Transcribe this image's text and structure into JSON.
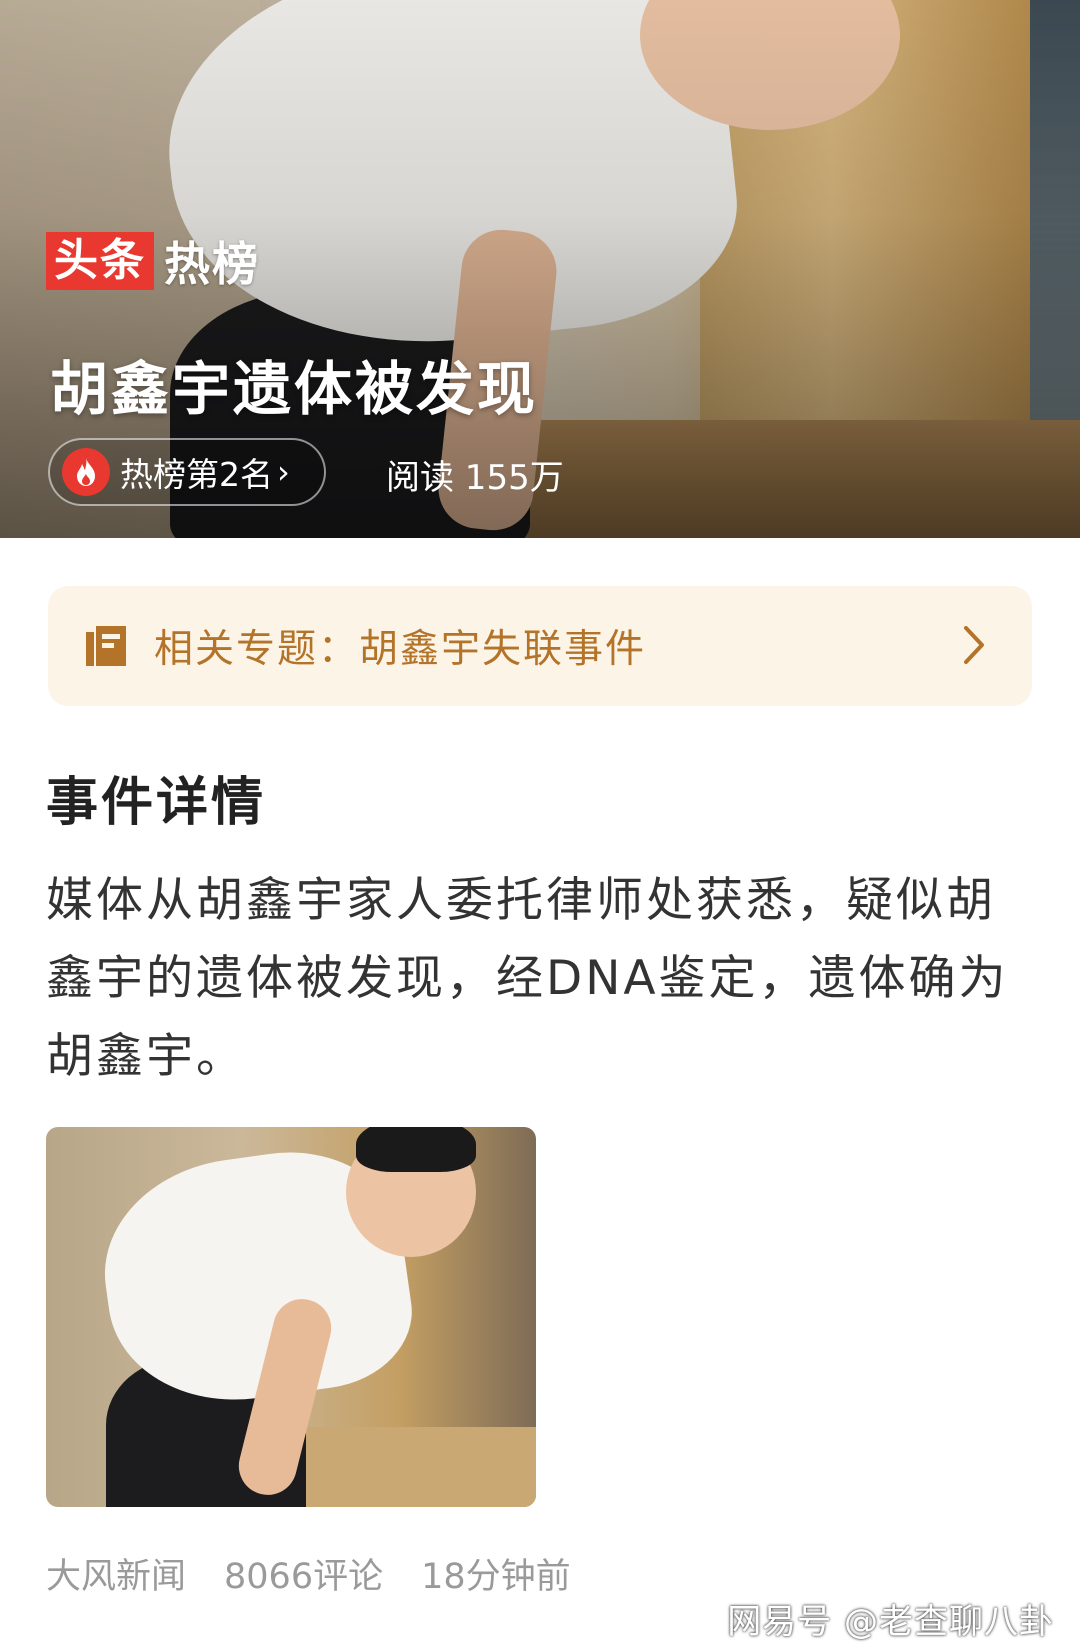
{
  "hero": {
    "brand_badge": "头条",
    "brand_suffix": "热榜",
    "title": "胡鑫宇遗体被发现",
    "rank_label": "热榜第2名",
    "rank_chevron": "›",
    "reads": "阅读 155万"
  },
  "topic_card": {
    "label": "相关专题：胡鑫宇失联事件",
    "icon": "document-icon",
    "chevron": "chevron-right-icon",
    "background_color": "#fdf4e8",
    "text_color": "#b3742a"
  },
  "details": {
    "title": "事件详情",
    "body": "媒体从胡鑫宇家人委托律师处获悉，疑似胡鑫宇的遗体被发现，经DNA鉴定，遗体确为胡鑫宇。"
  },
  "meta": {
    "source": "大风新闻",
    "comments": "8066评论",
    "time": "18分钟前"
  },
  "watermark": "网易号 @老查聊八卦",
  "colors": {
    "brand_red": "#e8382f",
    "meta_gray": "#9a9a9a"
  }
}
